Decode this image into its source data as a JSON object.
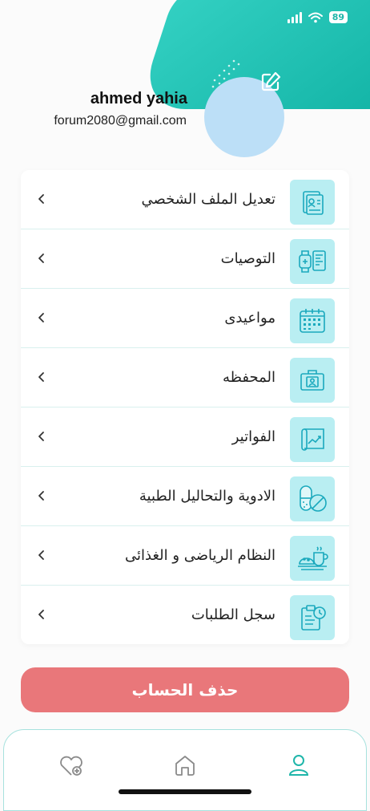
{
  "status_bar": {
    "battery": "89"
  },
  "profile": {
    "name": "ahmed yahia",
    "email": "forum2080@gmail.com"
  },
  "menu": {
    "items": [
      {
        "label": "تعديل الملف الشخصي",
        "icon": "profile-document-icon"
      },
      {
        "label": "التوصيات",
        "icon": "smartwatch-recommendations-icon"
      },
      {
        "label": "مواعيدى",
        "icon": "calendar-icon"
      },
      {
        "label": "المحفظه",
        "icon": "wallet-id-icon"
      },
      {
        "label": "الفواتير",
        "icon": "invoice-chart-icon"
      },
      {
        "label": "الادوية والتحاليل الطبية",
        "icon": "pills-icon"
      },
      {
        "label": "النظام الرياضى و الغذائى",
        "icon": "meal-coffee-icon"
      },
      {
        "label": "سجل الطلبات",
        "icon": "clipboard-clock-icon"
      }
    ]
  },
  "delete_account": {
    "label": "حذف الحساب"
  },
  "nav": {
    "items": [
      "heart-plus-icon",
      "home-icon",
      "user-icon"
    ],
    "active": "user-icon"
  },
  "colors": {
    "accent": "#1fb6aa",
    "icon_bg": "#b9eef2",
    "icon_stroke": "#1aa9bd",
    "danger": "#e9777a",
    "avatar": "#bcdff7"
  }
}
